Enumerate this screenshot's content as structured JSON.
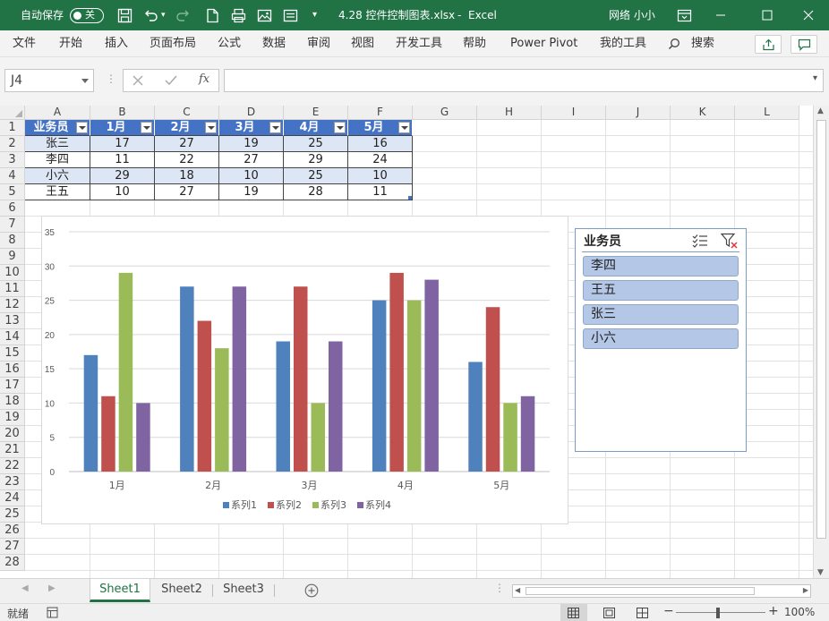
{
  "titlebar": {
    "autosave_label": "自动保存",
    "autosave_state": "关",
    "filename": "4.28 控件控制图表.xlsx",
    "app": "Excel",
    "user": "网络 小小",
    "bg_color": "#217346"
  },
  "menu": [
    "文件",
    "开始",
    "插入",
    "页面布局",
    "公式",
    "数据",
    "审阅",
    "视图",
    "开发工具",
    "帮助",
    "Power Pivot",
    "我的工具"
  ],
  "search_label": "搜索",
  "formula_bar": {
    "name_box": "J4",
    "fx": "fx",
    "content": ""
  },
  "columns": [
    "A",
    "B",
    "C",
    "D",
    "E",
    "F",
    "G",
    "H",
    "I",
    "J",
    "K",
    "L"
  ],
  "rows": [
    "1",
    "2",
    "3",
    "4",
    "5",
    "6",
    "7",
    "8",
    "9",
    "10",
    "11",
    "12",
    "13",
    "14",
    "15",
    "16",
    "17",
    "18",
    "19",
    "20",
    "21",
    "22",
    "23",
    "24",
    "25",
    "26",
    "27",
    "28"
  ],
  "table": {
    "headers": [
      "业务员",
      "1月",
      "2月",
      "3月",
      "4月",
      "5月"
    ],
    "rows": [
      [
        "张三",
        "17",
        "27",
        "19",
        "25",
        "16"
      ],
      [
        "李四",
        "11",
        "22",
        "27",
        "29",
        "24"
      ],
      [
        "小六",
        "29",
        "18",
        "10",
        "25",
        "10"
      ],
      [
        "王五",
        "10",
        "27",
        "19",
        "28",
        "11"
      ]
    ],
    "header_color": "#4472c4",
    "band_color": "#dde6f4"
  },
  "chart_data": {
    "type": "bar",
    "categories": [
      "1月",
      "2月",
      "3月",
      "4月",
      "5月"
    ],
    "series": [
      {
        "name": "系列1",
        "values": [
          17,
          27,
          19,
          25,
          16
        ],
        "color": "#4f81bd"
      },
      {
        "name": "系列2",
        "values": [
          11,
          22,
          27,
          29,
          24
        ],
        "color": "#c0504d"
      },
      {
        "name": "系列3",
        "values": [
          29,
          18,
          10,
          25,
          10
        ],
        "color": "#9bbb59"
      },
      {
        "name": "系列4",
        "values": [
          10,
          27,
          19,
          28,
          11
        ],
        "color": "#8064a2"
      }
    ],
    "title": "",
    "xlabel": "",
    "ylabel": "",
    "ylim": [
      0,
      35
    ],
    "yticks": [
      "0",
      "5",
      "10",
      "15",
      "20",
      "25",
      "30",
      "35"
    ],
    "grid": true,
    "legend": "bottom"
  },
  "slicer": {
    "title": "业务员",
    "items": [
      "李四",
      "王五",
      "张三",
      "小六"
    ],
    "item_color": "#b4c7e7"
  },
  "sheets": [
    "Sheet1",
    "Sheet2",
    "Sheet3"
  ],
  "active_sheet": "Sheet1",
  "status": {
    "ready": "就绪",
    "zoom": "100%"
  }
}
